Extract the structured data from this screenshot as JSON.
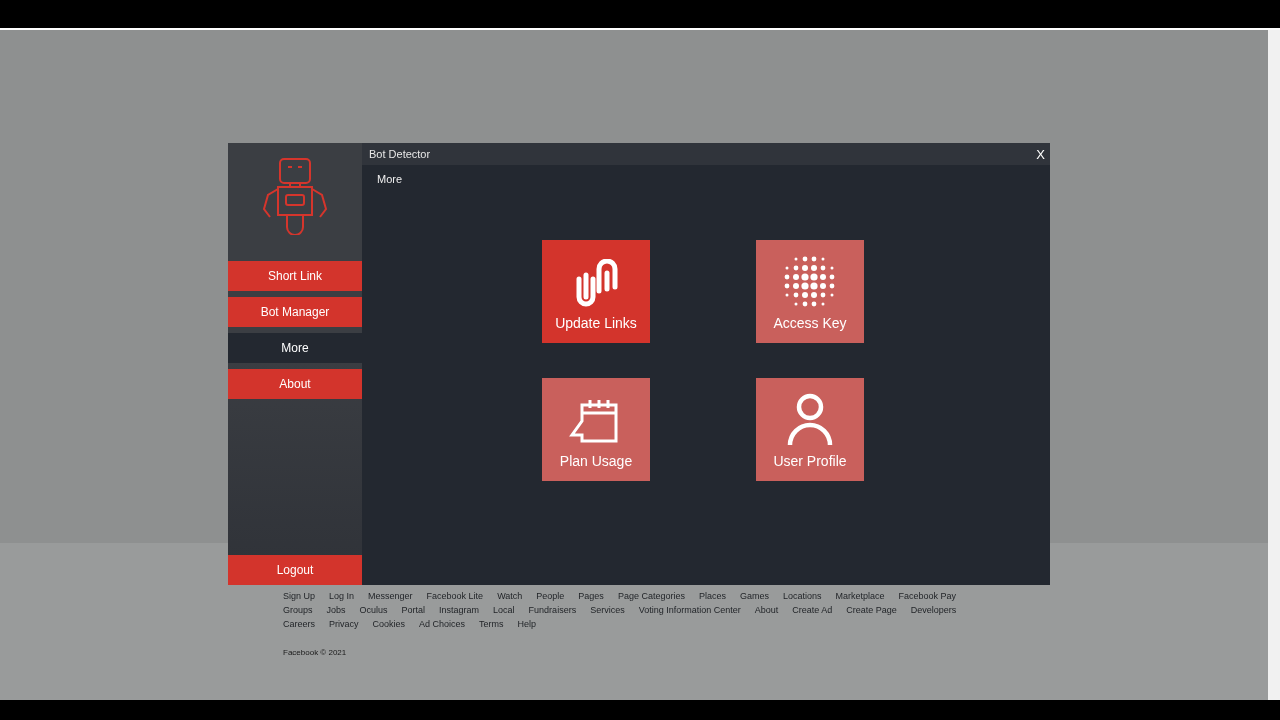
{
  "dialog": {
    "title": "Bot Detector",
    "close": "X",
    "heading": "More"
  },
  "sidebar": {
    "items": [
      {
        "label": "Short Link",
        "selected": false
      },
      {
        "label": "Bot Manager",
        "selected": false
      },
      {
        "label": "More",
        "selected": true
      },
      {
        "label": "About",
        "selected": false
      }
    ],
    "logout": "Logout"
  },
  "tiles": [
    {
      "kind": "links",
      "label": "Update Links",
      "highlighted": true
    },
    {
      "kind": "key",
      "label": "Access Key",
      "highlighted": false
    },
    {
      "kind": "calendar",
      "label": "Plan Usage",
      "highlighted": false
    },
    {
      "kind": "user",
      "label": "User Profile",
      "highlighted": false
    }
  ],
  "footer": {
    "links": [
      "Sign Up",
      "Log In",
      "Messenger",
      "Facebook Lite",
      "Watch",
      "People",
      "Pages",
      "Page Categories",
      "Places",
      "Games",
      "Locations",
      "Marketplace",
      "Facebook Pay",
      "Groups",
      "Jobs",
      "Oculus",
      "Portal",
      "Instagram",
      "Local",
      "Fundraisers",
      "Services",
      "Voting Information Center",
      "About",
      "Create Ad",
      "Create Page",
      "Developers",
      "Careers",
      "Privacy",
      "Cookies",
      "Ad Choices",
      "Terms",
      "Help"
    ],
    "copyright": "Facebook © 2021"
  }
}
